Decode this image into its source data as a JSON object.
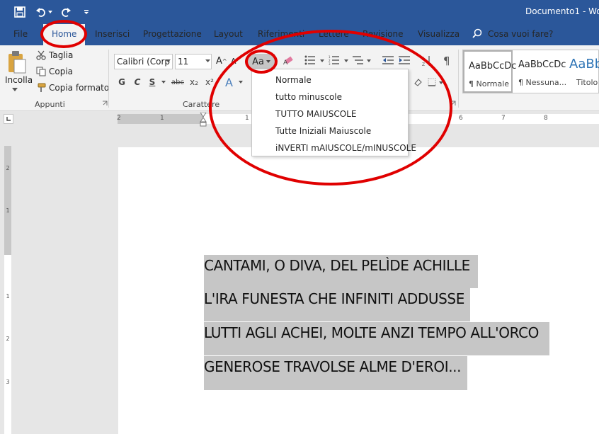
{
  "title_bar": {
    "document_title": "Documento1 - Wo",
    "quick_access": [
      "save-icon",
      "undo-icon",
      "redo-icon",
      "customize-icon"
    ]
  },
  "tabs": [
    {
      "label": "File"
    },
    {
      "label": "Home"
    },
    {
      "label": "Inserisci"
    },
    {
      "label": "Progettazione"
    },
    {
      "label": "Layout"
    },
    {
      "label": "Riferimenti"
    },
    {
      "label": "Lettere"
    },
    {
      "label": "Revisione"
    },
    {
      "label": "Visualizza"
    }
  ],
  "tell_me": {
    "label": "Cosa vuoi fare?"
  },
  "clipboard": {
    "paste": "Incolla",
    "cut": "Taglia",
    "copy": "Copia",
    "format_painter": "Copia formato",
    "group_label": "Appunti"
  },
  "font": {
    "font_name": "Calibri (Corp",
    "font_size": "11",
    "group_label": "Carattere",
    "bold": "G",
    "italic": "C",
    "underline": "S",
    "strikethrough": "abc",
    "subscript": "x₂",
    "superscript": "x²",
    "change_case": "Aa"
  },
  "styles": [
    {
      "sample": "AaBbCcDc",
      "name": "¶ Normale"
    },
    {
      "sample": "AaBbCcDc",
      "name": "¶ Nessuna..."
    },
    {
      "sample": "AaBb",
      "name": "Titolo"
    }
  ],
  "change_case_menu": [
    {
      "label": "Normale"
    },
    {
      "label": "tutto minuscole"
    },
    {
      "label": "TUTTO MAIUSCOLE"
    },
    {
      "label": "Tutte Iniziali Maiuscole"
    },
    {
      "label": "iNVERTI mAIUSCOLE/mINUSCOLE"
    }
  ],
  "ruler": {
    "h_ticks": [
      "2",
      "1",
      "1",
      "2",
      "6",
      "7",
      "8"
    ],
    "v_ticks": [
      "2",
      "1",
      "1",
      "2",
      "3"
    ]
  },
  "document": {
    "lines": [
      "CANTAMI, O DIVA, DEL PELÌDE ACHILLE",
      "L'IRA FUNESTA CHE INFINITI ADDUSSE",
      "LUTTI AGLI ACHEI, MOLTE ANZI TEMPO ALL'ORCO",
      "GENEROSE TRAVOLSE ALME D'EROI..."
    ]
  },
  "colors": {
    "ribbon_blue": "#2b579a",
    "highlight": "#c6c6c6",
    "annotation_red": "#e00000"
  }
}
